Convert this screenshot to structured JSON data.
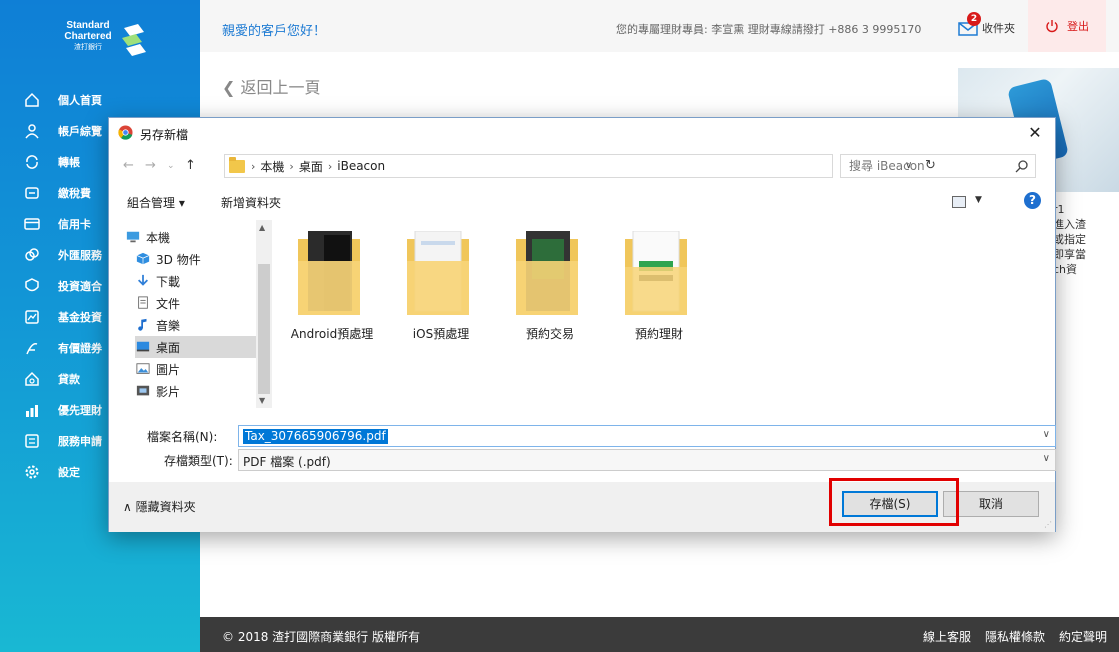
{
  "bank": {
    "logo_line1": "Standard",
    "logo_line2": "Chartered",
    "logo_line3": "渣打銀行",
    "brand_color": "#0f7fd6"
  },
  "sidebar": {
    "items": [
      {
        "label": "個人首頁",
        "icon": "home-icon"
      },
      {
        "label": "帳戶綜覽",
        "icon": "person-icon"
      },
      {
        "label": "轉帳",
        "icon": "transfer-icon"
      },
      {
        "label": "繳稅費",
        "icon": "bill-icon"
      },
      {
        "label": "信用卡",
        "icon": "credit-card-icon"
      },
      {
        "label": "外匯服務",
        "icon": "currency-icon"
      },
      {
        "label": "投資適合",
        "icon": "investment-icon"
      },
      {
        "label": "基金投資",
        "icon": "fund-icon"
      },
      {
        "label": "有價證券",
        "icon": "securities-icon"
      },
      {
        "label": "貸款",
        "icon": "loan-icon"
      },
      {
        "label": "優先理財",
        "icon": "priority-icon"
      },
      {
        "label": "服務申請",
        "icon": "service-icon"
      },
      {
        "label": "設定",
        "icon": "gear-icon"
      }
    ]
  },
  "header": {
    "greeting": "親愛的客戶您好！",
    "advisor": "您的專屬理財專員: 李宣熏 理財專線請撥打 +886 3 9995170",
    "inbox_label": "收件夾",
    "inbox_count": "2",
    "logout_label": "登出"
  },
  "content": {
    "back_label": "返回上一頁",
    "promo_text": "r1\n進入渣\n或指定\n即享當\nch資"
  },
  "footer": {
    "copyright": "© 2018 渣打國際商業銀行 版權所有",
    "links": [
      "線上客服",
      "隱私權條款",
      "約定聲明"
    ]
  },
  "dialog": {
    "title": "另存新檔",
    "breadcrumb": [
      "本機",
      "桌面",
      "iBeacon"
    ],
    "search_placeholder": "搜尋 iBeacon",
    "organize_label": "組合管理 ▾",
    "new_folder_label": "新增資料夾",
    "nav_pane": [
      {
        "label": "本機",
        "icon": "computer-icon"
      },
      {
        "label": "3D 物件",
        "icon": "3d-objects-icon"
      },
      {
        "label": "下載",
        "icon": "download-icon"
      },
      {
        "label": "文件",
        "icon": "documents-icon"
      },
      {
        "label": "音樂",
        "icon": "music-icon"
      },
      {
        "label": "桌面",
        "icon": "desktop-icon"
      },
      {
        "label": "圖片",
        "icon": "pictures-icon"
      },
      {
        "label": "影片",
        "icon": "videos-icon"
      }
    ],
    "selected_nav": "桌面",
    "folders": [
      {
        "name": "Android預處理"
      },
      {
        "name": "iOS預處理"
      },
      {
        "name": "預約交易"
      },
      {
        "name": "預約理財"
      }
    ],
    "filename_label": "檔案名稱(N):",
    "filename_value": "Tax_307665906796.pdf",
    "filetype_label": "存檔類型(T):",
    "filetype_value": "PDF 檔案 (.pdf)",
    "hide_folders_label": "隱藏資料夾",
    "save_label": "存檔(S)",
    "cancel_label": "取消",
    "highlight_color": "#e10000"
  }
}
